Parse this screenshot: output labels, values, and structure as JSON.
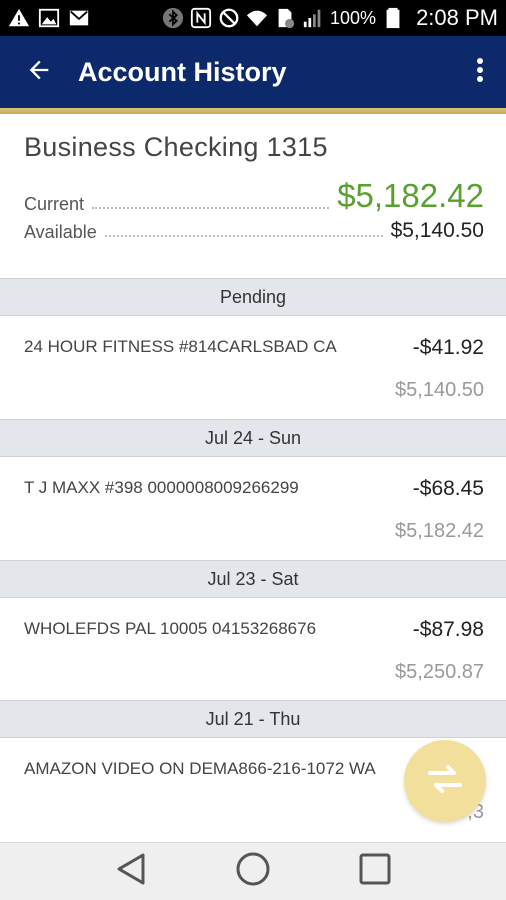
{
  "status_bar": {
    "battery": "100%",
    "time": "2:08 PM",
    "icons": [
      "warning-icon",
      "image-icon",
      "mail-icon",
      "bluetooth-icon",
      "nfc-icon",
      "do-not-disturb-icon",
      "wifi-icon",
      "sim-icon",
      "signal-icon",
      "battery-icon"
    ]
  },
  "app_bar": {
    "title": "Account History",
    "back_icon": "arrow-left-icon",
    "menu_icon": "more-vert-icon",
    "color": "#0c2a6b",
    "accent": "#c9b063"
  },
  "account": {
    "name": "Business Checking 1315",
    "current_label": "Current",
    "current_value": "$5,182.42",
    "current_color": "#5aa02c",
    "available_label": "Available",
    "available_value": "$5,140.50"
  },
  "groups": [
    {
      "header": "Pending",
      "transactions": [
        {
          "description": "24 HOUR FITNESS #814CARLSBAD CA",
          "amount": "-$41.92",
          "balance": "$5,140.50"
        }
      ]
    },
    {
      "header": "Jul 24 - Sun",
      "transactions": [
        {
          "description": "T J MAXX #398 0000008009266299",
          "amount": "-$68.45",
          "balance": "$5,182.42"
        }
      ]
    },
    {
      "header": "Jul 23 - Sat",
      "transactions": [
        {
          "description": "WHOLEFDS PAL 10005 04153268676",
          "amount": "-$87.98",
          "balance": "$5,250.87"
        }
      ]
    },
    {
      "header": "Jul 21 - Thu",
      "transactions": [
        {
          "description": "AMAZON VIDEO ON DEMA866-216-1072 WA",
          "amount": "",
          "balance": "$5,3"
        }
      ]
    }
  ],
  "fab": {
    "icon": "transfer-arrows-icon",
    "color": "#f2df9c"
  },
  "nav_bar": {
    "icons": [
      "back-triangle-icon",
      "home-circle-icon",
      "recents-square-icon"
    ]
  }
}
